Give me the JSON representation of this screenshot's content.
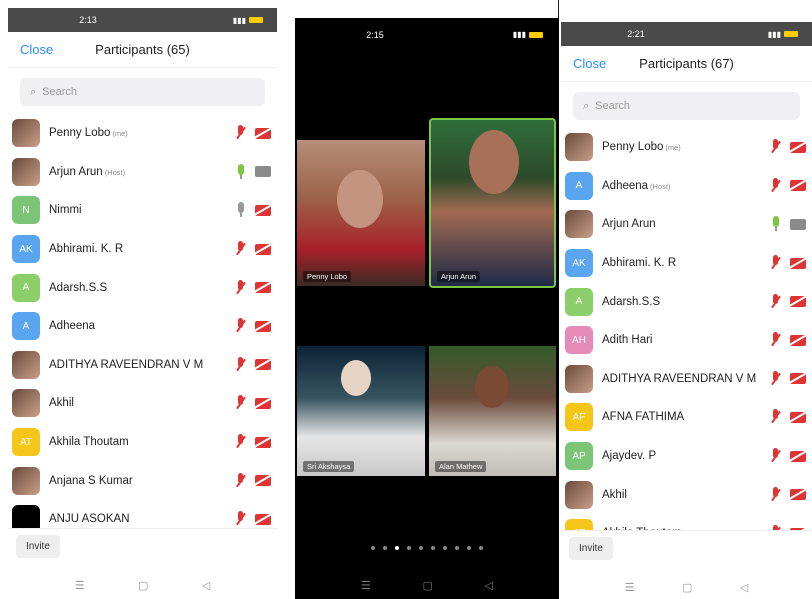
{
  "screens": [
    {
      "status_time": "2:13",
      "close_label": "Close",
      "title": "Participants (65)",
      "search_placeholder": "Search",
      "invite_label": "Invite",
      "participants": [
        {
          "name": "Penny Lobo",
          "tag": "(me)",
          "initials": "",
          "avatar_color": "",
          "photo": true,
          "mic": "muted",
          "cam": "off"
        },
        {
          "name": "Arjun Arun",
          "tag": "(Host)",
          "initials": "",
          "avatar_color": "",
          "photo": true,
          "mic": "on",
          "cam": "on"
        },
        {
          "name": "Nimmi",
          "tag": "",
          "initials": "N",
          "avatar_color": "#7cc576",
          "photo": false,
          "mic": "gray",
          "cam": "off"
        },
        {
          "name": "Abhirami. K. R",
          "tag": "",
          "initials": "AK",
          "avatar_color": "#5aa5f0",
          "photo": false,
          "mic": "muted",
          "cam": "off"
        },
        {
          "name": "Adarsh.S.S",
          "tag": "",
          "initials": "A",
          "avatar_color": "#8ccf6a",
          "photo": false,
          "mic": "muted",
          "cam": "off"
        },
        {
          "name": "Adheena",
          "tag": "",
          "initials": "A",
          "avatar_color": "#5aa5f0",
          "photo": false,
          "mic": "muted",
          "cam": "off"
        },
        {
          "name": "ADITHYA RAVEENDRAN V M",
          "tag": "",
          "initials": "",
          "avatar_color": "",
          "photo": true,
          "mic": "muted",
          "cam": "off"
        },
        {
          "name": "Akhil",
          "tag": "",
          "initials": "",
          "avatar_color": "",
          "photo": true,
          "mic": "muted",
          "cam": "off"
        },
        {
          "name": "Akhila Thoutam",
          "tag": "",
          "initials": "AT",
          "avatar_color": "#f5c518",
          "photo": false,
          "mic": "muted",
          "cam": "off"
        },
        {
          "name": "Anjana S Kumar",
          "tag": "",
          "initials": "",
          "avatar_color": "",
          "photo": true,
          "mic": "muted",
          "cam": "off"
        },
        {
          "name": "ANJU ASOKAN",
          "tag": "",
          "initials": "",
          "avatar_color": "#000000",
          "photo": false,
          "mic": "muted",
          "cam": "off"
        }
      ]
    },
    {
      "status_time": "2:21",
      "close_label": "Close",
      "title": "Participants (67)",
      "search_placeholder": "Search",
      "invite_label": "Invite",
      "participants": [
        {
          "name": "Penny Lobo",
          "tag": "(me)",
          "initials": "",
          "avatar_color": "",
          "photo": true,
          "mic": "muted",
          "cam": "off"
        },
        {
          "name": "Adheena",
          "tag": "(Host)",
          "initials": "A",
          "avatar_color": "#5aa5f0",
          "photo": false,
          "mic": "muted",
          "cam": "off"
        },
        {
          "name": "Arjun Arun",
          "tag": "",
          "initials": "",
          "avatar_color": "",
          "photo": true,
          "mic": "on",
          "cam": "on"
        },
        {
          "name": "Abhirami. K. R",
          "tag": "",
          "initials": "AK",
          "avatar_color": "#5aa5f0",
          "photo": false,
          "mic": "muted",
          "cam": "off"
        },
        {
          "name": "Adarsh.S.S",
          "tag": "",
          "initials": "A",
          "avatar_color": "#8ccf6a",
          "photo": false,
          "mic": "muted",
          "cam": "off"
        },
        {
          "name": "Adith Hari",
          "tag": "",
          "initials": "AH",
          "avatar_color": "#e68ab8",
          "photo": false,
          "mic": "muted",
          "cam": "off"
        },
        {
          "name": "ADITHYA RAVEENDRAN V M",
          "tag": "",
          "initials": "",
          "avatar_color": "",
          "photo": true,
          "mic": "muted",
          "cam": "off"
        },
        {
          "name": "AFNA FATHIMA",
          "tag": "",
          "initials": "AF",
          "avatar_color": "#f5c518",
          "photo": false,
          "mic": "muted",
          "cam": "off"
        },
        {
          "name": "Ajaydev. P",
          "tag": "",
          "initials": "AP",
          "avatar_color": "#7cc576",
          "photo": false,
          "mic": "muted",
          "cam": "off"
        },
        {
          "name": "Akhil",
          "tag": "",
          "initials": "",
          "avatar_color": "",
          "photo": true,
          "mic": "muted",
          "cam": "off"
        },
        {
          "name": "Akhila Thoutam",
          "tag": "",
          "initials": "AT",
          "avatar_color": "#f5c518",
          "photo": false,
          "mic": "muted",
          "cam": "off"
        }
      ]
    }
  ],
  "gallery": {
    "status_time": "2:15",
    "tiles": [
      {
        "name": "Penny Lobo",
        "active": false
      },
      {
        "name": "Arjun Arun",
        "active": true
      },
      {
        "name": "Sri Akshaysa",
        "active": false
      },
      {
        "name": "Alan Mathew",
        "active": false
      }
    ],
    "page_dots": 10,
    "active_dot": 3
  },
  "nav_icons": [
    "menu-icon",
    "home-icon",
    "back-icon"
  ],
  "colors": {
    "accent": "#2d8cff",
    "muted_red": "#e03333",
    "active_green": "#7bc744"
  }
}
